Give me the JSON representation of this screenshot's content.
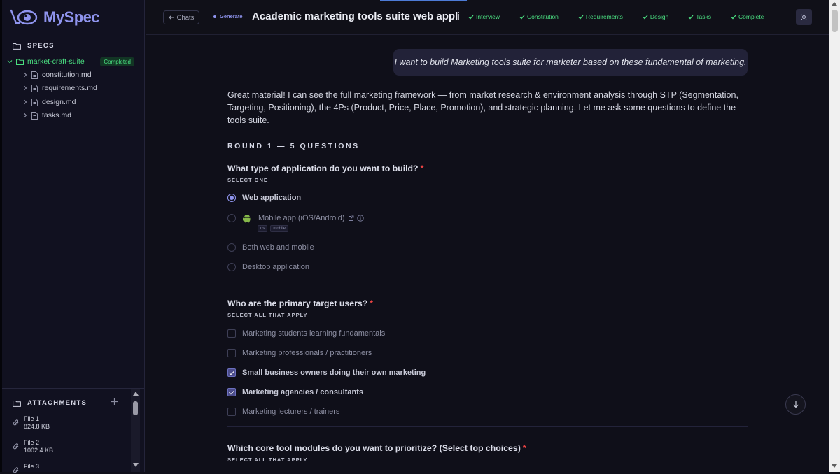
{
  "app": {
    "brand": "MySpec"
  },
  "sidebar": {
    "specs_title": "SPECS",
    "project": {
      "name": "market-craft-suite",
      "status": "Completed"
    },
    "files": [
      {
        "name": "constitution.md"
      },
      {
        "name": "requirements.md"
      },
      {
        "name": "design.md"
      },
      {
        "name": "tasks.md"
      }
    ],
    "attachments_title": "ATTACHMENTS",
    "attachments": [
      {
        "name": "File 1",
        "size": "824.8 KB"
      },
      {
        "name": "File 2",
        "size": "1002.4 KB"
      },
      {
        "name": "File 3",
        "size": ""
      }
    ]
  },
  "header": {
    "back_label": "Chats",
    "mode_label": "Generate",
    "title": "Academic marketing tools suite web appli...",
    "steps": [
      {
        "label": "Interview",
        "done": true
      },
      {
        "label": "Constitution",
        "done": true
      },
      {
        "label": "Requirements",
        "done": true
      },
      {
        "label": "Design",
        "done": true
      },
      {
        "label": "Tasks",
        "done": true
      },
      {
        "label": "Complete",
        "done": true
      }
    ]
  },
  "chat": {
    "user_message": "I want to build Marketing tools suite for marketer based on these fundamental of marketing.",
    "assistant_intro": "Great material! I can see the full marketing framework — from market research & environment analysis through STP (Segmentation, Targeting, Positioning), the 4Ps (Product, Price, Place, Promotion), and strategic planning. Let me ask some questions to define the tools suite.",
    "round_label": "ROUND 1 — 5 QUESTIONS",
    "questions": [
      {
        "title": "What type of application do you want to build?",
        "required_mark": "*",
        "mode": "SELECT ONE",
        "options": [
          {
            "label": "Web application",
            "selected": true
          },
          {
            "label": "Mobile app (iOS/Android)",
            "selected": false,
            "tags": [
              "os",
              "mobile"
            ]
          },
          {
            "label": "Both web and mobile",
            "selected": false
          },
          {
            "label": "Desktop application",
            "selected": false
          }
        ]
      },
      {
        "title": "Who are the primary target users?",
        "required_mark": "*",
        "mode": "SELECT ALL THAT APPLY",
        "options": [
          {
            "label": "Marketing students learning fundamentals",
            "selected": false
          },
          {
            "label": "Marketing professionals / practitioners",
            "selected": false
          },
          {
            "label": "Small business owners doing their own marketing",
            "selected": true
          },
          {
            "label": "Marketing agencies / consultants",
            "selected": true
          },
          {
            "label": "Marketing lecturers / trainers",
            "selected": false
          }
        ]
      },
      {
        "title": "Which core tool modules do you want to prioritize? (Select top choices)",
        "required_mark": "*",
        "mode": "SELECT ALL THAT APPLY",
        "options": []
      }
    ]
  },
  "colors": {
    "accent": "#8f94ee",
    "success": "#4ade80",
    "required": "#ef4444",
    "background": "#0f0f19"
  }
}
